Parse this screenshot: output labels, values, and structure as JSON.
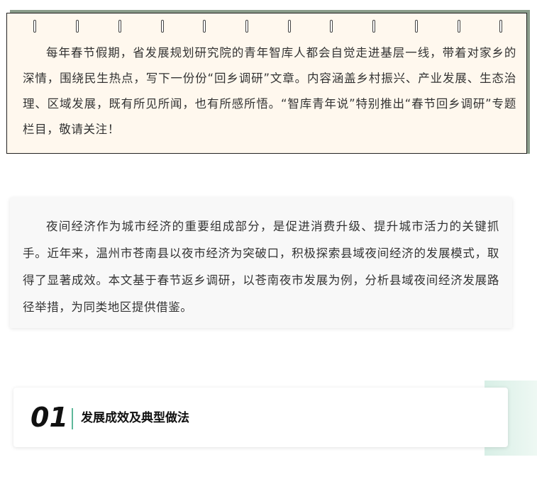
{
  "intro": {
    "text": "每年春节假期，省发展规划研究院的青年智库人都会自觉走进基层一线，带着对家乡的深情，围绕民生热点，写下一份份“回乡调研”文章。内容涵盖乡村振兴、产业发展、生态治理、区域发展，既有所见所闻，也有所感所悟。“智库青年说”特别推出“春节回乡调研”专题栏目，敬请关注！"
  },
  "summary": {
    "text": "夜间经济作为城市经济的重要组成部分，是促进消费升级、提升城市活力的关键抓手。近年来，温州市苍南县以夜市经济为突破口，积极探索县域夜间经济的发展模式，取得了显著成效。本文基于春节返乡调研，以苍南夜市发展为例，分析县域夜间经济发展路径举措，为同类地区提供借鉴。"
  },
  "section": {
    "number": "01",
    "title": "发展成效及典型做法"
  },
  "colors": {
    "notebook_bg": "#fff8ee",
    "notebook_shadow": "#8a9c8a",
    "summary_bg": "#f8f8f8",
    "accent_green": "#5fb89a",
    "accent_block": "#d8efe6"
  }
}
